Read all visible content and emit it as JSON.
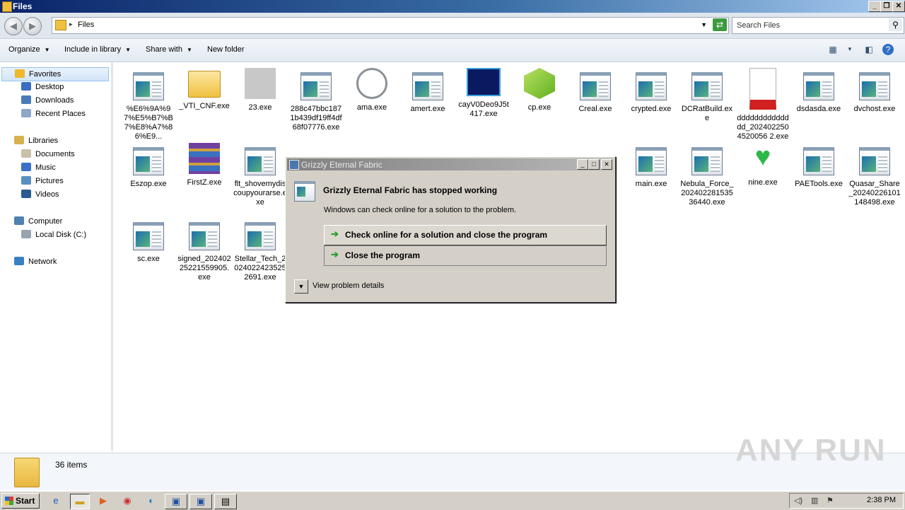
{
  "window": {
    "title": "Files"
  },
  "address": {
    "path": "Files",
    "search_placeholder": "Search Files"
  },
  "toolbar": {
    "organize": "Organize",
    "include": "Include in library",
    "share": "Share with",
    "new_folder": "New folder"
  },
  "nav": {
    "favorites": "Favorites",
    "desktop": "Desktop",
    "downloads": "Downloads",
    "recent": "Recent Places",
    "libraries": "Libraries",
    "documents": "Documents",
    "music": "Music",
    "pictures": "Pictures",
    "videos": "Videos",
    "computer": "Computer",
    "localdisk": "Local Disk (C:)",
    "network": "Network"
  },
  "files": [
    "%E6%9A%97%E5%B7%B7%E8%A7%86%E9...",
    "_VTI_CNF.exe",
    "23.exe",
    "288c47bbc1871b439df19ff4df68f07776.exe",
    "ama.exe",
    "amert.exe",
    "cayV0Deo9J5t417.exe",
    "cp.exe",
    "Creal.exe",
    "crypted.exe",
    "DCRatBuild.exe",
    "dddddddddddddd_2024022504520056 2.exe",
    "dsdasda.exe",
    "dvchost.exe",
    "Eszop.exe",
    "FirstZ.exe",
    "flt_shovemydiscoupyourarse.exe",
    "main.exe",
    "Nebula_Force_20240228153536440.exe",
    "nine.exe",
    "PAETools.exe",
    "Quasar_Share_20240226101148498.exe",
    "sc.exe",
    "signed_20240225221559905.exe",
    "Stellar_Tech_20240224235252691.exe"
  ],
  "status": {
    "count": "36 items"
  },
  "watermark": "ANY RUN",
  "taskbar": {
    "start": "Start",
    "clock": "2:38 PM"
  },
  "dialog": {
    "title": "Grizzly Eternal Fabric",
    "heading": "Grizzly Eternal Fabric has stopped working",
    "message": "Windows can check online for a solution to the problem.",
    "option1": "Check online for a solution and close the program",
    "option2": "Close the program",
    "details": "View problem details"
  }
}
